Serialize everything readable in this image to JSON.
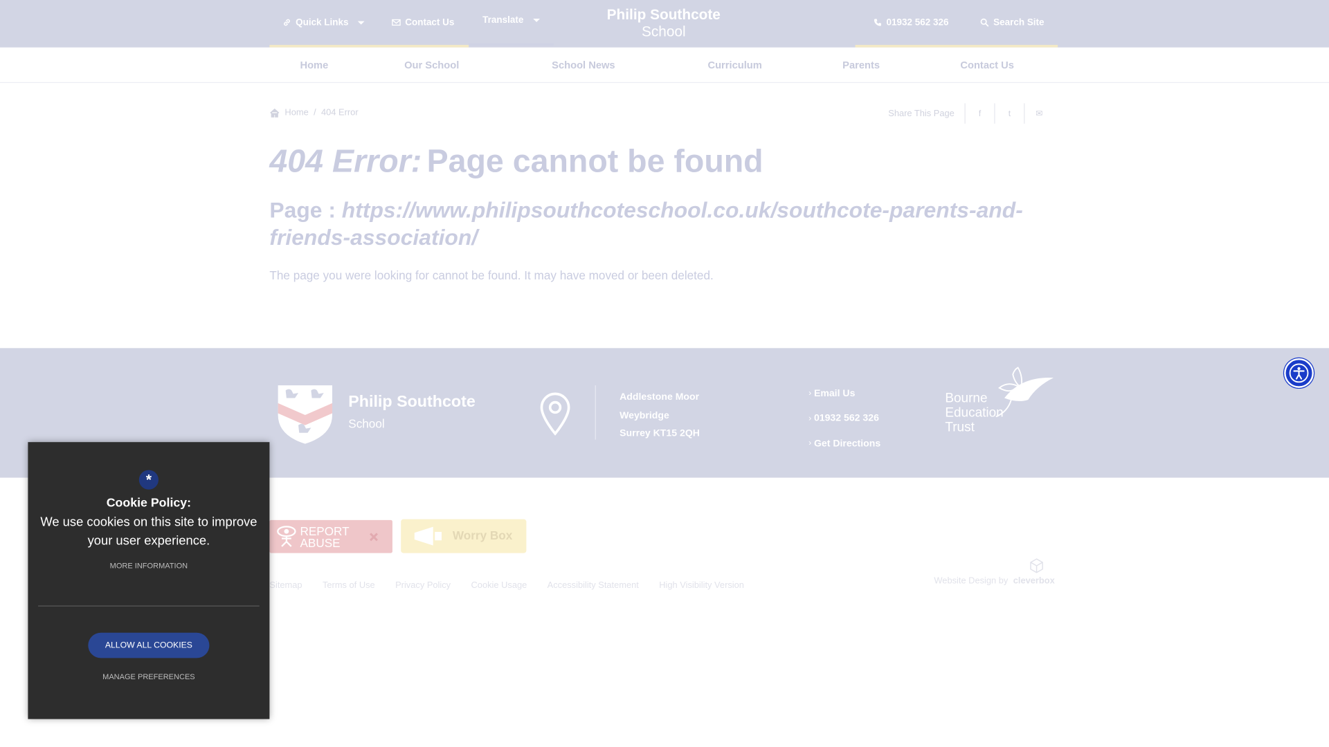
{
  "topbar": {
    "quick_links": "Quick Links",
    "contact_us": "Contact Us",
    "translate": "Translate",
    "school_name_line1": "Philip Southcote",
    "school_name_line2": "School",
    "phone": "01932 562 326",
    "search": "Search Site"
  },
  "nav": {
    "items": [
      "Home",
      "Our School",
      "School News",
      "Curriculum",
      "Parents",
      "Contact Us"
    ]
  },
  "breadcrumb": {
    "home": "Home",
    "separator": "/",
    "current": "404 Error"
  },
  "share": {
    "label": "Share This Page",
    "facebook": "f",
    "twitter": "t",
    "email": "✉"
  },
  "content": {
    "error_label": "404 Error:",
    "heading": "Page cannot be found",
    "page_prefix": "Page :",
    "page_url": "https://www.philipsouthcoteschool.co.uk/southcote-parents-and-friends-association/",
    "message": "The page you were looking for cannot be found. It may have moved or been deleted."
  },
  "footer": {
    "school_name": "Philip Southcote",
    "school_sub": "School",
    "address": [
      "Addlestone Moor",
      "Weybridge",
      "Surrey KT15 2QH"
    ],
    "links": [
      "Email Us",
      "01932 562 326",
      "Get Directions"
    ],
    "trust": [
      "Bourne",
      "Education",
      "Trust"
    ]
  },
  "badges": {
    "report_abuse": [
      "REPORT",
      "ABUSE"
    ],
    "worry_box": "Worry Box"
  },
  "legal_links": [
    "Sitemap",
    "Terms of Use",
    "Privacy Policy",
    "Cookie Usage",
    "Accessibility Statement",
    "High Visibility Version"
  ],
  "credit": {
    "label": "Website Design by",
    "brand": "cleverbox"
  },
  "cookie": {
    "badge": "*",
    "title": "Cookie Policy:",
    "body": "We use cookies on this site to improve your user experience.",
    "more_info": "MORE INFORMATION",
    "allow": "ALLOW ALL COOKIES",
    "manage": "MANAGE PREFERENCES"
  },
  "icons": [
    "link-icon",
    "envelope-icon",
    "phone-icon",
    "search-icon",
    "home-icon",
    "map-pin-icon",
    "accessibility-icon"
  ],
  "colors": {
    "header_bg": "#d2d5e4",
    "accent_gold": "#f3e9c6",
    "cookie_bg": "#2d2d2d",
    "cookie_button": "#2a4795",
    "accessibility_button": "#1a3cc9"
  }
}
